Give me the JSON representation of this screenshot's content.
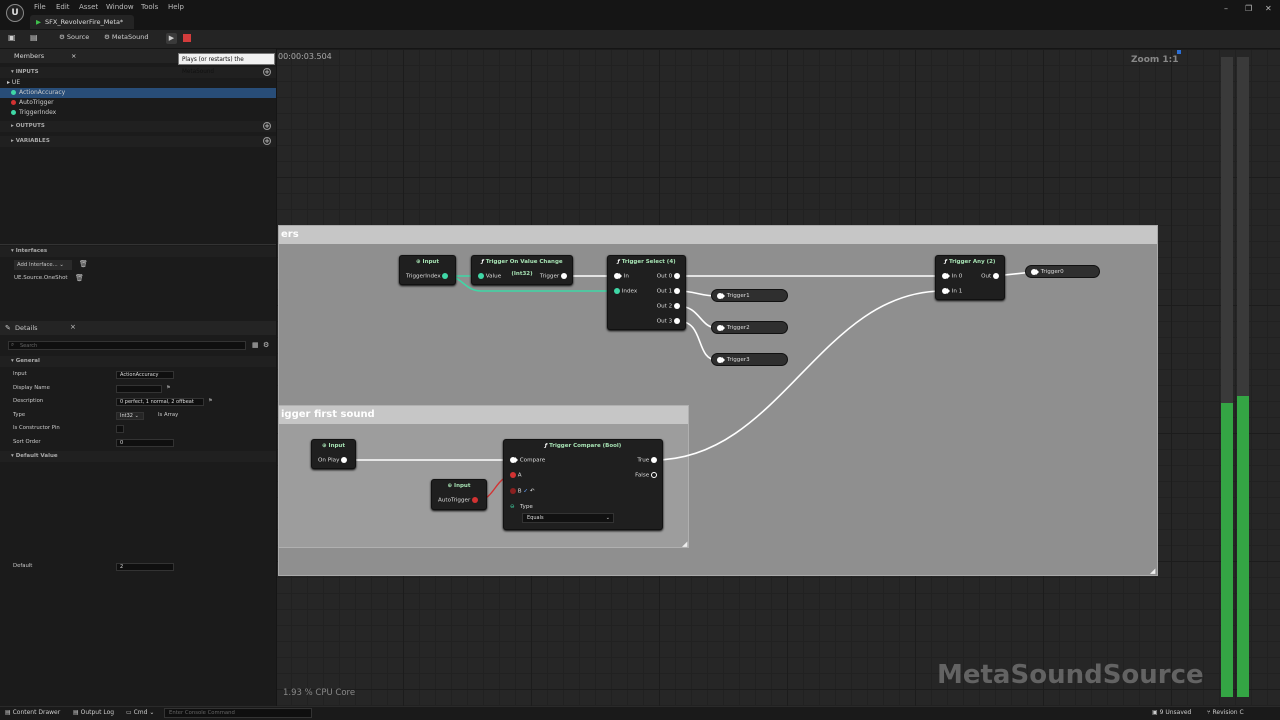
{
  "menu": {
    "logo": "U",
    "items": [
      "File",
      "Edit",
      "Asset",
      "Window",
      "Tools",
      "Help"
    ]
  },
  "asset_tab": {
    "label": "SFX_RevolverFire_Meta*",
    "close": "×"
  },
  "toolbar": {
    "source_label": "Source",
    "metasound_label": "MetaSound",
    "tooltip": "Plays (or restarts) the MetaSound"
  },
  "members": {
    "tab_label": "Members",
    "inputs_label": "INPUTS",
    "ue_label": "UE",
    "inputs": [
      {
        "name": "ActionAccuracy",
        "color": "#3fd7a6"
      },
      {
        "name": "AutoTrigger",
        "color": "#d23232"
      },
      {
        "name": "TriggerIndex",
        "color": "#3fd7a6"
      }
    ],
    "outputs_label": "OUTPUTS",
    "variables_label": "VARIABLES"
  },
  "interfaces": {
    "label": "Interfaces",
    "add_label": "Add Interface...",
    "item": "UE.Source.OneShot"
  },
  "details": {
    "tab_label": "Details",
    "search_placeholder": "Search",
    "general_label": "General",
    "rows": [
      {
        "label": "Input",
        "value": "ActionAccuracy"
      },
      {
        "label": "Display Name",
        "value": ""
      },
      {
        "label": "Description",
        "value": "0 perfect, 1 normal, 2 offbeat"
      },
      {
        "label": "Type",
        "value": "Int32",
        "extra": "Is Array"
      },
      {
        "label": "Is Constructor Pin",
        "value": ""
      },
      {
        "label": "Sort Order",
        "value": "0"
      }
    ],
    "default_value_label": "Default Value",
    "default_row": {
      "label": "Default",
      "value": "2"
    }
  },
  "graph": {
    "timecode": "00:00:03.504",
    "zoom": "Zoom 1:1",
    "cpu": "1.93 % CPU Core",
    "watermark": "MetaSoundSource",
    "comment1_title": "ers",
    "comment2_title": "igger first sound",
    "nodes": {
      "input_trigger_index": {
        "title": "Input",
        "pin": "TriggerIndex"
      },
      "trigger_on_value_change": {
        "title": "Trigger On Value Change (Int32)",
        "in": "Value",
        "out": "Trigger"
      },
      "trigger_select": {
        "title": "Trigger Select (4)",
        "in0": "In",
        "in1": "Index",
        "outs": [
          "Out 0",
          "Out 1",
          "Out 2",
          "Out 3"
        ]
      },
      "trigger_any": {
        "title": "Trigger Any (2)",
        "in0": "In 0",
        "in1": "In 1",
        "out": "Out"
      },
      "outputs": [
        "Trigger0",
        "Trigger1",
        "Trigger2",
        "Trigger3"
      ],
      "input_on_play": {
        "title": "Input",
        "pin": "On Play"
      },
      "input_auto_trigger": {
        "title": "Input",
        "pin": "AutoTrigger"
      },
      "trigger_compare": {
        "title": "Trigger Compare (Bool)",
        "compare": "Compare",
        "a": "A",
        "b": "B",
        "true": "True",
        "false": "False",
        "type_label": "Type",
        "type_value": "Equals"
      }
    }
  },
  "statusbar": {
    "content_drawer": "Content Drawer",
    "output_log": "Output Log",
    "cmd": "Cmd",
    "console_placeholder": "Enter Console Command",
    "unsaved": "9 Unsaved",
    "revision": "Revision C"
  },
  "meters": {
    "left_level": 0.46,
    "right_level": 0.47
  },
  "colors": {
    "trigger_wire": "#ffffff",
    "int_wire": "#3fd7a6",
    "bool_wire": "#d23232",
    "meter": "#34a544"
  }
}
